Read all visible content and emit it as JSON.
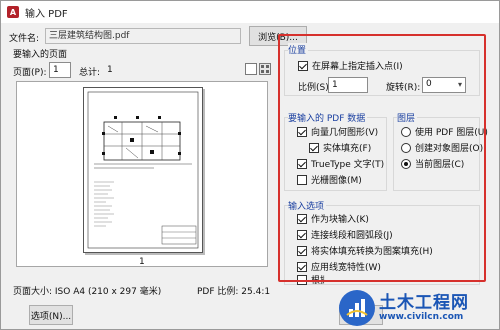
{
  "window": {
    "title": "输入 PDF"
  },
  "file": {
    "label": "文件名:",
    "value": "三层建筑结构图.pdf",
    "browse_label": "浏览(B)..."
  },
  "pages": {
    "section_label": "要输入的页面",
    "page_label": "页面(P):",
    "page_value": "1",
    "total_label": "总计:",
    "total_value": "1",
    "preview_page_number": "1"
  },
  "page_info": {
    "size_label": "页面大小: ISO A4 (210 x 297 毫米)",
    "scale_label": "PDF 比例: 25.4:1"
  },
  "options_button": "选项(N)...",
  "position": {
    "title": "位置",
    "specify_on_screen": "在屏幕上指定插入点(I)",
    "specify_checked": true,
    "scale_label": "比例(S):",
    "scale_value": "1",
    "rotation_label": "旋转(R):",
    "rotation_value": "0"
  },
  "pdf_data": {
    "title": "要输入的 PDF 数据",
    "items": [
      {
        "label": "向量几何图形(V)",
        "checked": true
      },
      {
        "label": "实体填充(F)",
        "checked": true
      },
      {
        "label": "TrueType 文字(T)",
        "checked": true
      },
      {
        "label": "光栅图像(M)",
        "checked": false
      }
    ]
  },
  "layers": {
    "title": "图层",
    "options": [
      {
        "label": "使用 PDF 图层(U)",
        "selected": false
      },
      {
        "label": "创建对象图层(O)",
        "selected": false
      },
      {
        "label": "当前图层(C)",
        "selected": true
      }
    ]
  },
  "import_options": {
    "title": "输入选项",
    "items": [
      {
        "label": "作为块输入(K)",
        "checked": true
      },
      {
        "label": "连接线段和圆弧段(J)",
        "checked": true
      },
      {
        "label": "将实体填充转换为图案填充(H)",
        "checked": true
      },
      {
        "label": "应用线宽特性(W)",
        "checked": true
      },
      {
        "label": "根据共线虚线段推断线型(Q)",
        "checked": false
      }
    ]
  },
  "watermark": {
    "title": "土木工程网",
    "url": "www.civilcn.com"
  },
  "colors": {
    "highlight_frame": "#d6302c",
    "group_title": "#1a3fa0",
    "watermark": "#1b56b5"
  }
}
